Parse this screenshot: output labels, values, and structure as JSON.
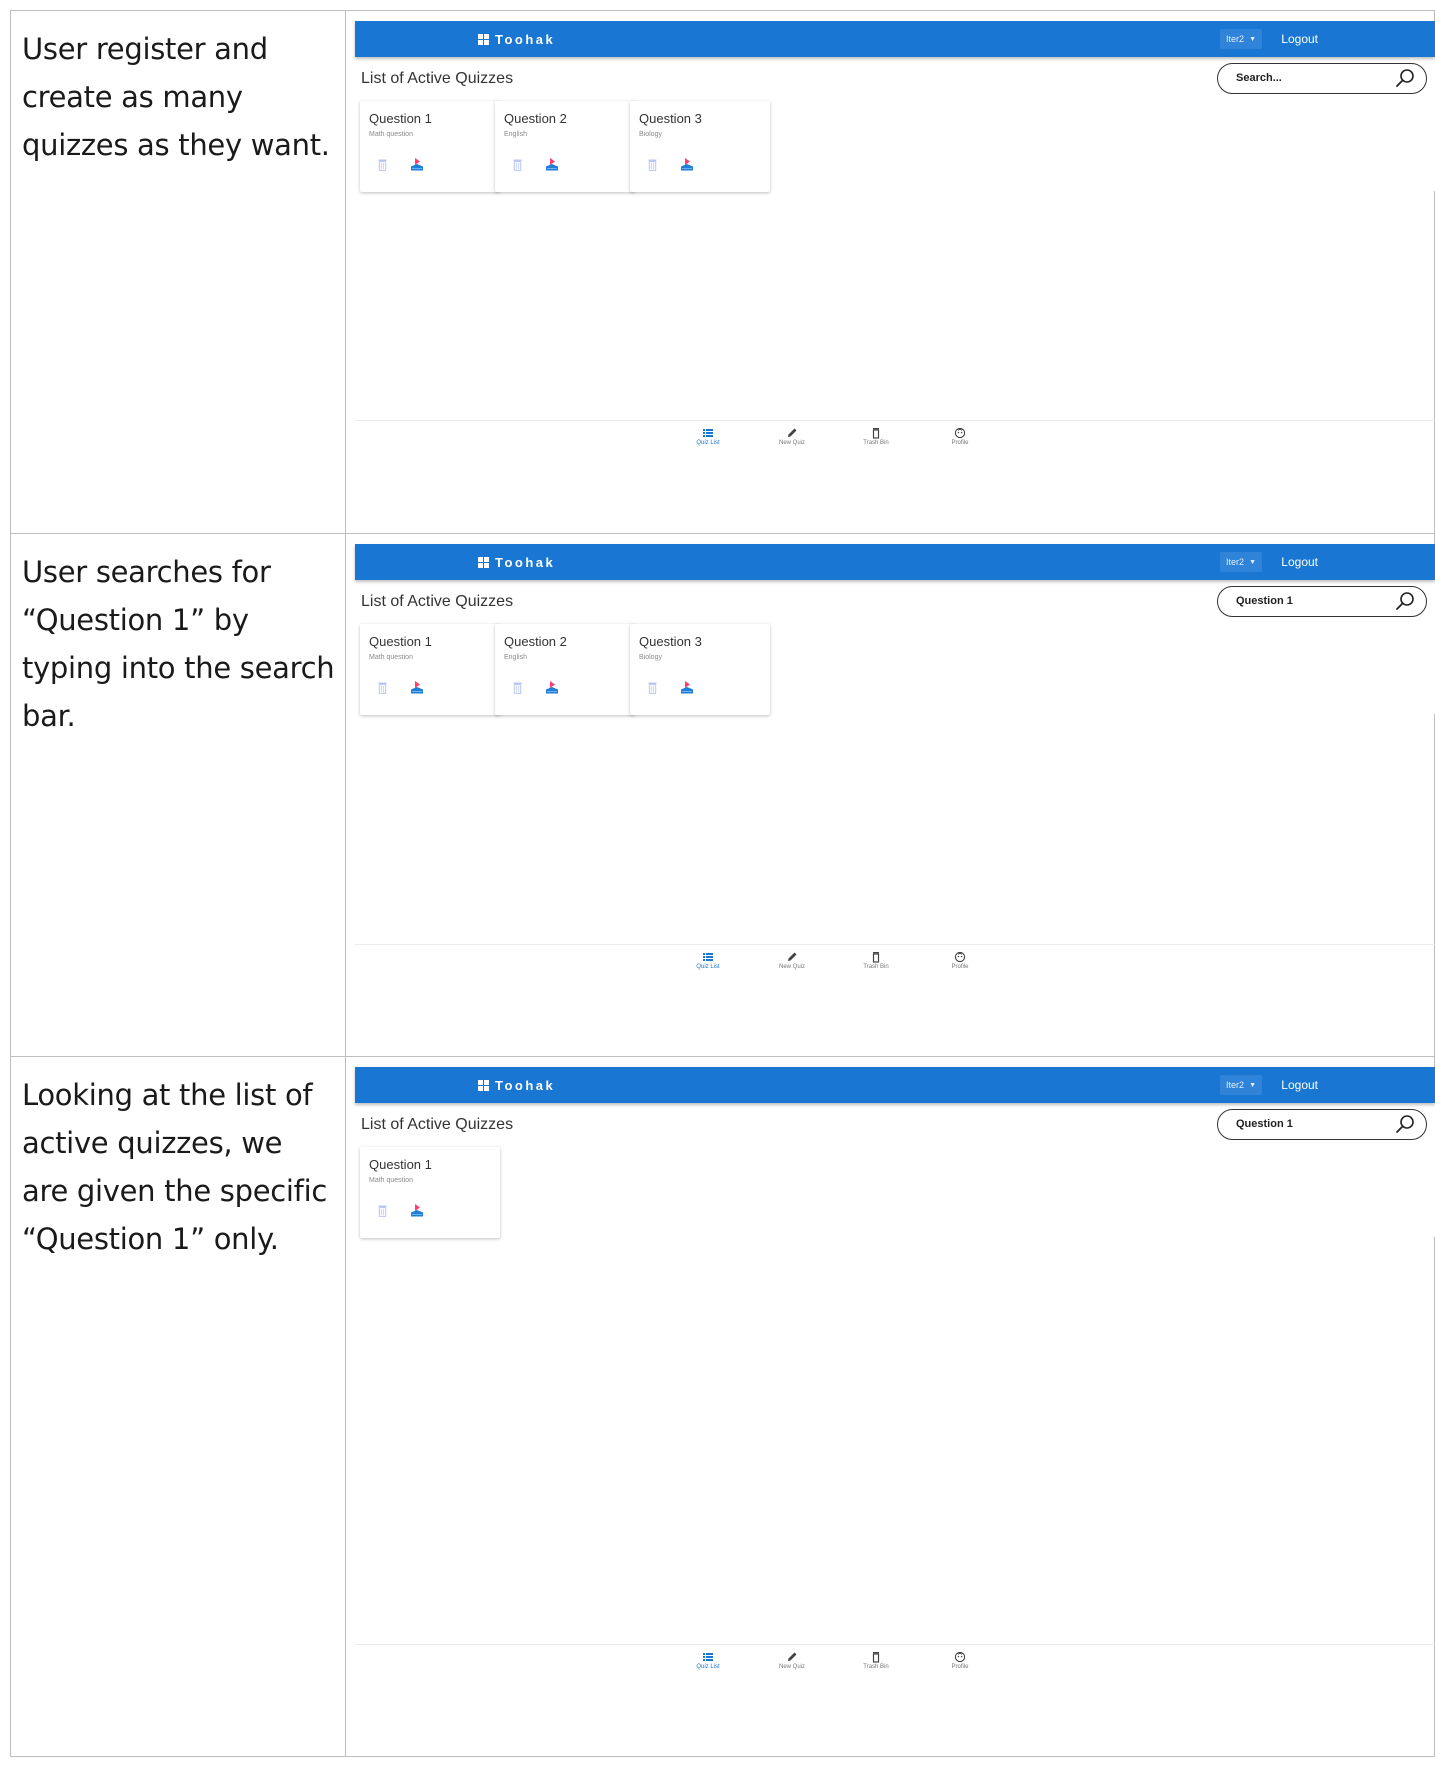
{
  "steps": [
    {
      "description": "User register and create as many quizzes as they want.",
      "app": {
        "brand": "Toohak",
        "user_menu": "Iter2",
        "logout_label": "Logout",
        "section_title": "List of Active Quizzes",
        "search": {
          "value": "",
          "placeholder": "Search..."
        },
        "quizzes": [
          {
            "title": "Question 1",
            "subtitle": "Math question"
          },
          {
            "title": "Question 2",
            "subtitle": "English"
          },
          {
            "title": "Question 3",
            "subtitle": "Biology"
          }
        ],
        "nav": [
          "Quiz List",
          "New Quiz",
          "Trash Bin",
          "Profile"
        ]
      }
    },
    {
      "description": "User searches for “Question 1” by typing into the search bar.",
      "app": {
        "brand": "Toohak",
        "user_menu": "Iter2",
        "logout_label": "Logout",
        "section_title": "List of Active Quizzes",
        "search": {
          "value": "Question 1",
          "placeholder": ""
        },
        "quizzes": [
          {
            "title": "Question 1",
            "subtitle": "Math question"
          },
          {
            "title": "Question 2",
            "subtitle": "English"
          },
          {
            "title": "Question 3",
            "subtitle": "Biology"
          }
        ],
        "nav": [
          "Quiz List",
          "New Quiz",
          "Trash Bin",
          "Profile"
        ]
      }
    },
    {
      "description": "Looking at the list of active quizzes, we are given the specific “Question 1” only.",
      "app": {
        "brand": "Toohak",
        "user_menu": "Iter2",
        "logout_label": "Logout",
        "section_title": "List of Active Quizzes",
        "search": {
          "value": "Question 1",
          "placeholder": ""
        },
        "quizzes": [
          {
            "title": "Question 1",
            "subtitle": "Math question"
          }
        ],
        "nav": [
          "Quiz List",
          "New Quiz",
          "Trash Bin",
          "Profile"
        ]
      }
    }
  ],
  "colors": {
    "app_bar": "#1976d2",
    "nav_active": "#1976d2",
    "trash_icon": "#b9c4f5",
    "play_icon_top": "#ff3d6e",
    "play_icon_bottom": "#1f7fd6"
  },
  "icons": {
    "brand": "dashboard-icon",
    "search": "search-icon",
    "card_delete": "trash-icon",
    "card_start": "play-icon",
    "nav": [
      "list-icon",
      "pencil-icon",
      "trash-icon",
      "profile-icon"
    ]
  }
}
